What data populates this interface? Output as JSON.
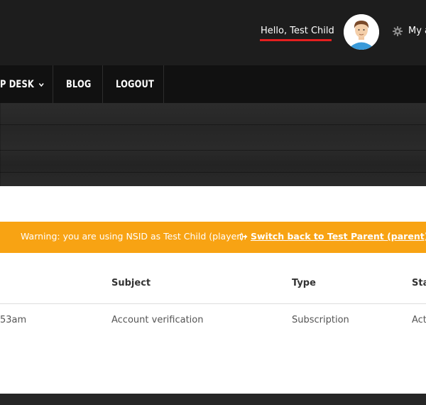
{
  "header": {
    "greeting": "Hello, Test Child",
    "avatar": "user-avatar",
    "my_account_label": "My a"
  },
  "nav": {
    "items": [
      {
        "label": "P DESK",
        "has_dropdown": true
      },
      {
        "label": "BLOG",
        "has_dropdown": false
      },
      {
        "label": "LOGOUT",
        "has_dropdown": false
      }
    ]
  },
  "warning": {
    "message": "Warning: you are using NSID as Test Child (player).",
    "switch_link": "Switch back to Test Parent (parent)"
  },
  "table": {
    "headers": [
      "Subject",
      "Type",
      "Sta"
    ],
    "rows": [
      {
        "date": "53am",
        "subject": "Account verification",
        "type": "Subscription",
        "status": "Act"
      }
    ]
  },
  "colors": {
    "topbar": "#1d1d1d",
    "navbar": "#111111",
    "accent_red": "#e41f1f",
    "warning_bg": "#f8a313"
  }
}
